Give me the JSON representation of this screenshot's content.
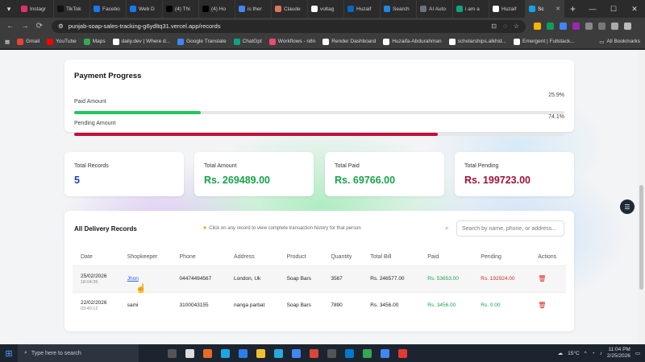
{
  "browser": {
    "tabs": [
      {
        "label": "Instagr",
        "color": "#e1306c"
      },
      {
        "label": "TikTok",
        "color": "#111111"
      },
      {
        "label": "Facebo",
        "color": "#1877f2"
      },
      {
        "label": "Web D",
        "color": "#1877f2"
      },
      {
        "label": "(4) Thi",
        "color": "#000000"
      },
      {
        "label": "(4) Ho",
        "color": "#000000"
      },
      {
        "label": "is ther",
        "color": "#4285f4"
      },
      {
        "label": "Claude",
        "color": "#d97757"
      },
      {
        "label": "voltag",
        "color": "#ffffff"
      },
      {
        "label": "Huzaif",
        "color": "#0a66c2"
      },
      {
        "label": "Search",
        "color": "#1e88e5"
      },
      {
        "label": "AI Auto",
        "color": "#6b7280"
      },
      {
        "label": "i am a",
        "color": "#10a37f"
      },
      {
        "label": "Huzaif",
        "color": "#ffffff"
      },
      {
        "label": "Sc",
        "color": "#0ea5e9",
        "active": true
      }
    ],
    "url": "punjab-soap-sales-tracking-g6ydltq31.vercel.app/records",
    "bookmarks": [
      {
        "label": "Gmail",
        "color": "#ea4335"
      },
      {
        "label": "YouTube",
        "color": "#ff0000"
      },
      {
        "label": "Maps",
        "color": "#34a853"
      },
      {
        "label": "daily.dev | Where d...",
        "color": "#ffffff"
      },
      {
        "label": "Google Translate",
        "color": "#4285f4"
      },
      {
        "label": "ChatGpt",
        "color": "#10a37f"
      },
      {
        "label": "Workflows - n8n",
        "color": "#ea4b71"
      },
      {
        "label": "Render Dashboard",
        "color": "#ffffff"
      },
      {
        "label": "Huzaifa-Abdurahman",
        "color": "#ffffff"
      },
      {
        "label": "scholarships.alkhid...",
        "color": "#ffffff"
      },
      {
        "label": "Emergent | Fullstack...",
        "color": "#ffffff"
      }
    ],
    "all_bookmarks": "All Bookmarks"
  },
  "progress": {
    "title": "Payment Progress",
    "paid_label": "Paid Amount",
    "paid_pct": "25.9%",
    "paid_fraction": 0.259,
    "paid_color": "#22c55e",
    "pending_label": "Pending Amount",
    "pending_pct": "74.1%",
    "pending_fraction": 0.741,
    "pending_color": "#be123c"
  },
  "stats": [
    {
      "label": "Total Records",
      "value": "5",
      "color": "#1e40af"
    },
    {
      "label": "Total Amount",
      "value": "Rs. 269489.00",
      "color": "#16a34a"
    },
    {
      "label": "Total Paid",
      "value": "Rs. 69766.00",
      "color": "#16a34a"
    },
    {
      "label": "Total Pending",
      "value": "Rs. 199723.00",
      "color": "#9f1239"
    }
  ],
  "records": {
    "title": "All Delivery Records",
    "hint": "Click on any record to view complete transaction history for that person",
    "search_placeholder": "Search by name, phone, or address...",
    "columns": [
      "Date",
      "Shopkeeper",
      "Phone",
      "Address",
      "Product",
      "Quantity",
      "Total Bill",
      "Paid",
      "Pending",
      "Actions"
    ],
    "rows": [
      {
        "date": "25/02/2026",
        "time": "18:04:35",
        "shopkeeper": "Jhon",
        "phone": "04474494567",
        "address": "London, Uk",
        "product": "Soap Bars",
        "quantity": "3567",
        "total": "Rs. 246577.00",
        "paid": "Rs. 53653.00",
        "pending": "Rs. 192924.00"
      },
      {
        "date": "22/02/2026",
        "time": "03:40:12",
        "shopkeeper": "sami",
        "phone": "3100043155",
        "address": "nanga parbat",
        "product": "Soap Bars",
        "quantity": "7890",
        "total": "Rs. 3456.00",
        "paid": "Rs. 3456.00",
        "pending": "Rs. 0.00"
      }
    ]
  },
  "taskbar": {
    "search_placeholder": "Type here to search",
    "weather": "15°C",
    "time": "11:04 PM",
    "date": "2/25/2026"
  }
}
